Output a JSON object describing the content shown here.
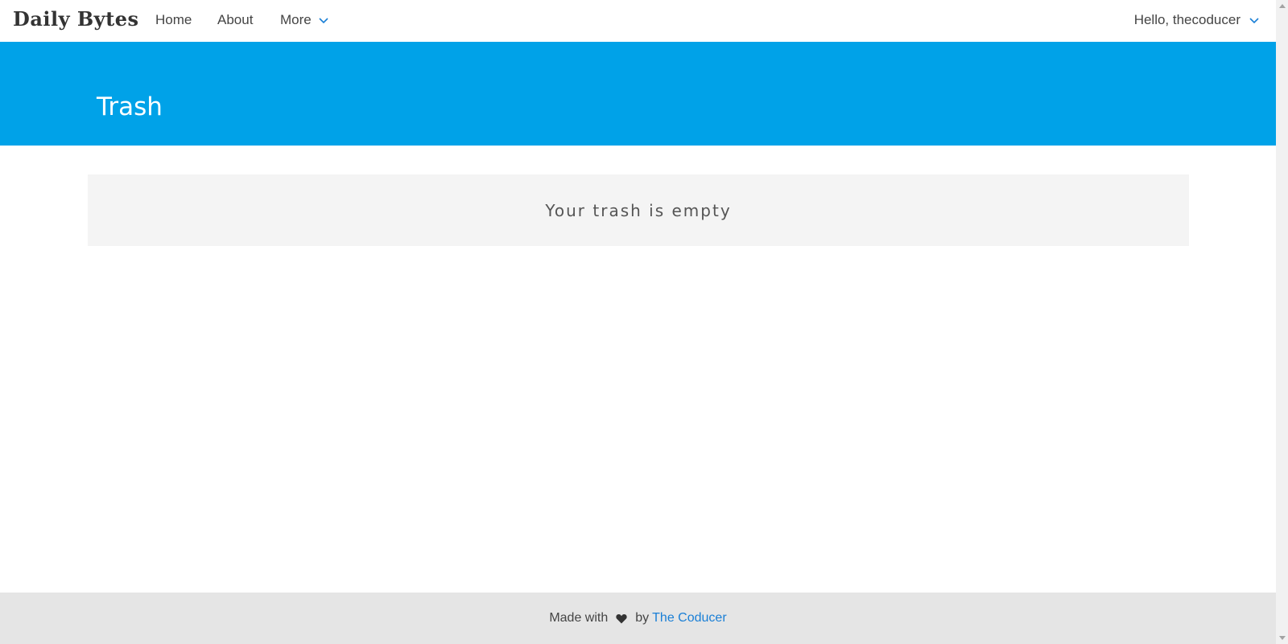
{
  "nav": {
    "brand": "Daily Bytes",
    "links": [
      "Home",
      "About",
      "More"
    ],
    "user_menu": "Hello, thecoducer"
  },
  "banner": {
    "title": "Trash",
    "color": "#00a2e8"
  },
  "main": {
    "empty_message": "Your trash is empty"
  },
  "footer": {
    "prefix": "Made with",
    "icon": "heart-icon",
    "by": "by",
    "author": "The Coducer"
  },
  "colors": {
    "accent": "#00a2e8",
    "link": "#1a7fd6",
    "footer_bg": "#e5e5e5"
  }
}
